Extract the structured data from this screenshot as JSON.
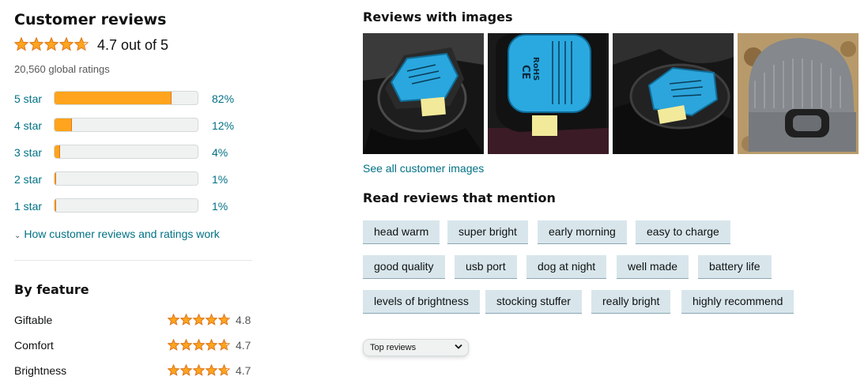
{
  "reviews": {
    "title": "Customer reviews",
    "rating": 4.7,
    "average_text": "4.7 out of 5",
    "global_ratings": "20,560 global ratings",
    "histogram": [
      {
        "label": "5 star",
        "percent": 82,
        "percent_text": "82%"
      },
      {
        "label": "4 star",
        "percent": 12,
        "percent_text": "12%"
      },
      {
        "label": "3 star",
        "percent": 4,
        "percent_text": "4%"
      },
      {
        "label": "2 star",
        "percent": 1,
        "percent_text": "1%"
      },
      {
        "label": "1 star",
        "percent": 1,
        "percent_text": "1%"
      }
    ],
    "how_link": "How customer reviews and ratings work"
  },
  "features": {
    "title": "By feature",
    "items": [
      {
        "name": "Giftable",
        "rating": 4.8,
        "value": "4.8"
      },
      {
        "name": "Comfort",
        "rating": 4.7,
        "value": "4.7"
      },
      {
        "name": "Brightness",
        "rating": 4.7,
        "value": "4.7"
      }
    ]
  },
  "images": {
    "title": "Reviews with images",
    "see_all": "See all customer images",
    "items": [
      {
        "name": "review-photo-1"
      },
      {
        "name": "review-photo-2",
        "label_text": "CE RoHS MADE IN CHINA"
      },
      {
        "name": "review-photo-3"
      },
      {
        "name": "review-photo-4"
      }
    ]
  },
  "mentions": {
    "title": "Read reviews that mention",
    "chips": [
      "head warm",
      "super bright",
      "early morning",
      "easy to charge",
      "good quality",
      "usb port",
      "dog at night",
      "well made",
      "battery life",
      "levels of brightness",
      "stocking stuffer",
      "really bright",
      "highly recommend"
    ]
  },
  "sort": {
    "selected": "Top reviews",
    "icon": "chevron-down-icon"
  },
  "colors": {
    "star": "#ffa41c",
    "star_outline": "#de7921",
    "link": "#007185",
    "chip_bg": "#d8e6ec",
    "bar_fill": "#ffa41c",
    "bar_track": "#f0f2f2"
  }
}
